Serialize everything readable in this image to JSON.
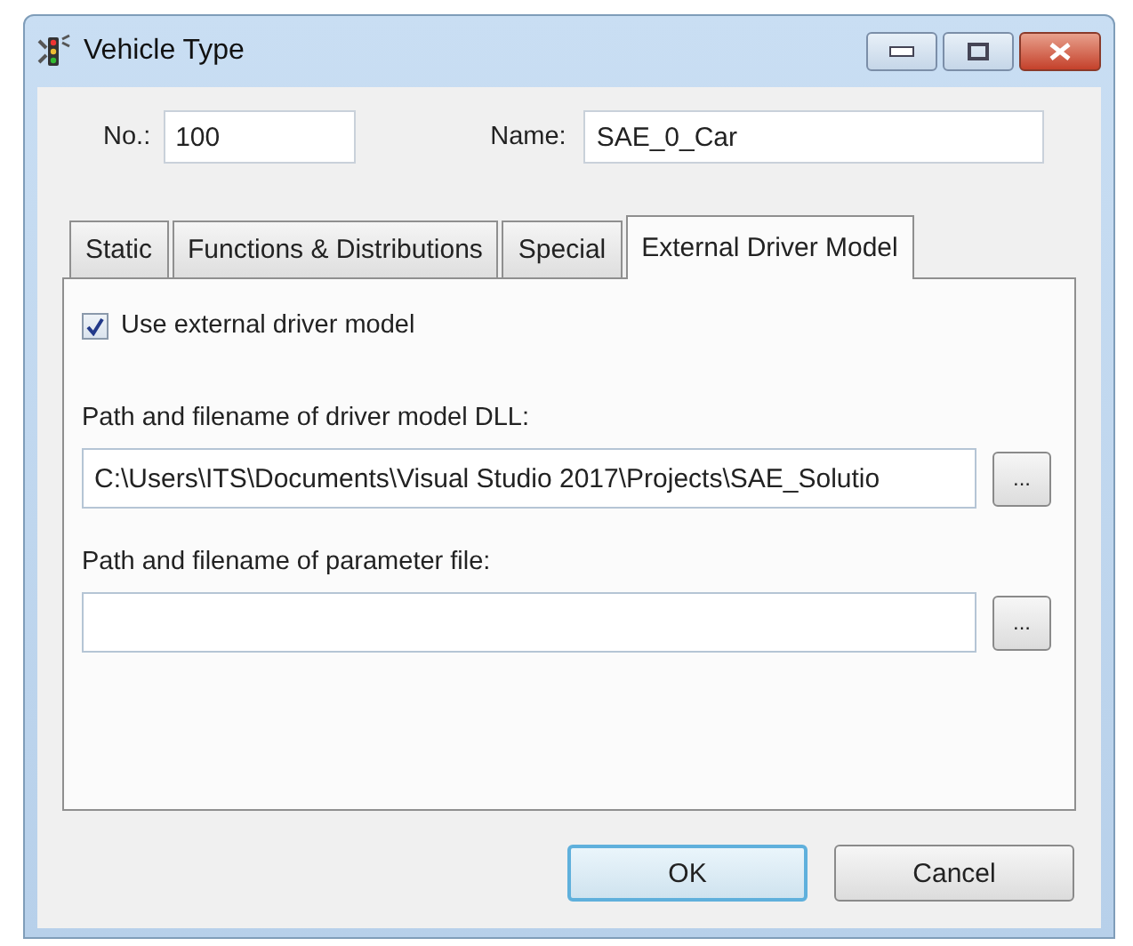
{
  "window": {
    "title": "Vehicle Type"
  },
  "fields": [
    {
      "label": "No.:",
      "value": "100"
    },
    {
      "label": "Name:",
      "value": "SAE_0_Car"
    }
  ],
  "tabs": [
    {
      "label": "Static",
      "selected": false
    },
    {
      "label": "Functions & Distributions",
      "selected": false
    },
    {
      "label": "Special",
      "selected": false
    },
    {
      "label": "External Driver Model",
      "selected": true
    }
  ],
  "use_external_driver_model": {
    "label": "Use external driver model",
    "checked": true
  },
  "paths": [
    {
      "label": "Path and filename of driver model DLL:",
      "value": "C:\\Users\\ITS\\Documents\\Visual Studio 2017\\Projects\\SAE_Solutio",
      "button": "..."
    },
    {
      "label": "Path and filename of parameter file:",
      "button": "..."
    }
  ],
  "buttons": [
    {
      "label": "OK",
      "default": true
    },
    {
      "label": "Cancel",
      "default": false
    }
  ]
}
